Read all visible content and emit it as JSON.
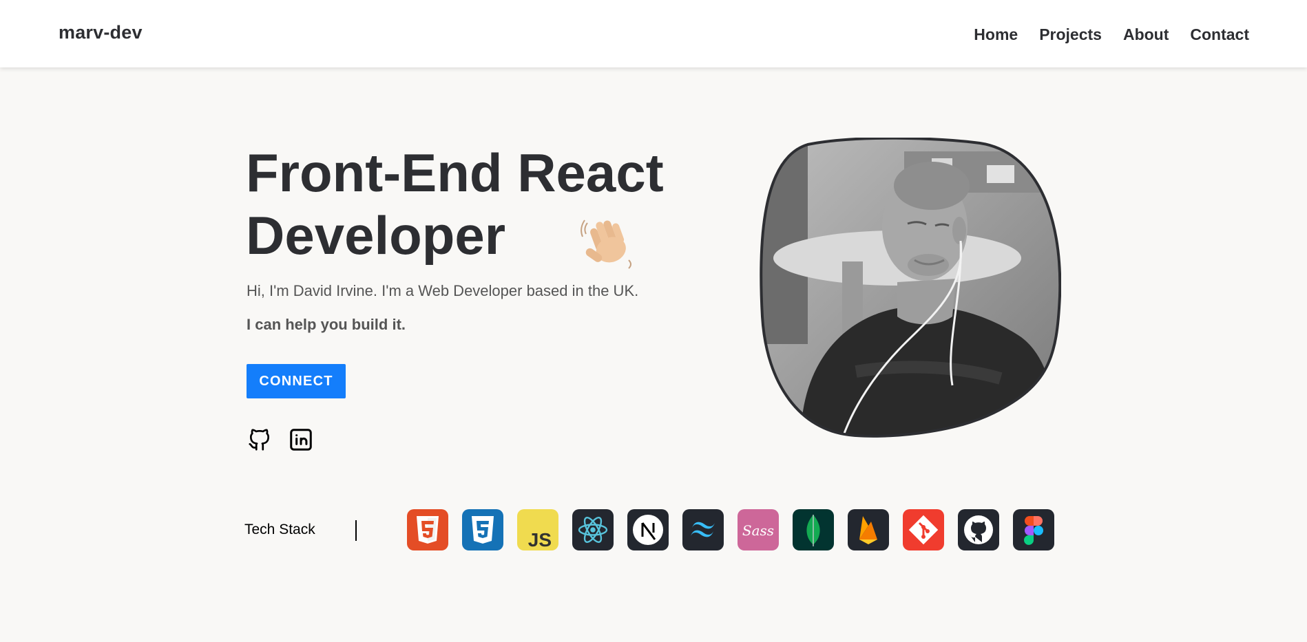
{
  "header": {
    "logo": "marv-dev",
    "nav": [
      "Home",
      "Projects",
      "About",
      "Contact"
    ]
  },
  "hero": {
    "title_line1": "Front-End React",
    "title_line2": "Developer",
    "wave_icon": "waving-hand-icon",
    "intro": "Hi, I'm David Irvine. I'm a Web Developer based in the UK.",
    "pitch": "I can help you build it.",
    "cta_label": "CONNECT",
    "cta_color": "#147efb",
    "social": [
      "github-icon",
      "linkedin-icon"
    ]
  },
  "portrait": {
    "style": "grayscale photo in blob frame",
    "border_color": "#2d2e32"
  },
  "tech_stack": {
    "label": "Tech Stack",
    "icons": [
      {
        "name": "html5-icon",
        "bg": "#e44d26"
      },
      {
        "name": "css3-icon",
        "bg": "#1572b6"
      },
      {
        "name": "javascript-icon",
        "bg": "#f0db4f",
        "text": "JS"
      },
      {
        "name": "react-icon",
        "bg": "#23272f"
      },
      {
        "name": "nextjs-icon",
        "bg": "#23272f"
      },
      {
        "name": "tailwind-icon",
        "bg": "#23272f"
      },
      {
        "name": "sass-icon",
        "bg": "#cd6799",
        "text": "Sass"
      },
      {
        "name": "mongodb-icon",
        "bg": "#023430"
      },
      {
        "name": "firebase-icon",
        "bg": "#23272f"
      },
      {
        "name": "git-icon",
        "bg": "#f03c2e"
      },
      {
        "name": "github-icon",
        "bg": "#23272f"
      },
      {
        "name": "figma-icon",
        "bg": "#23272f"
      }
    ]
  }
}
